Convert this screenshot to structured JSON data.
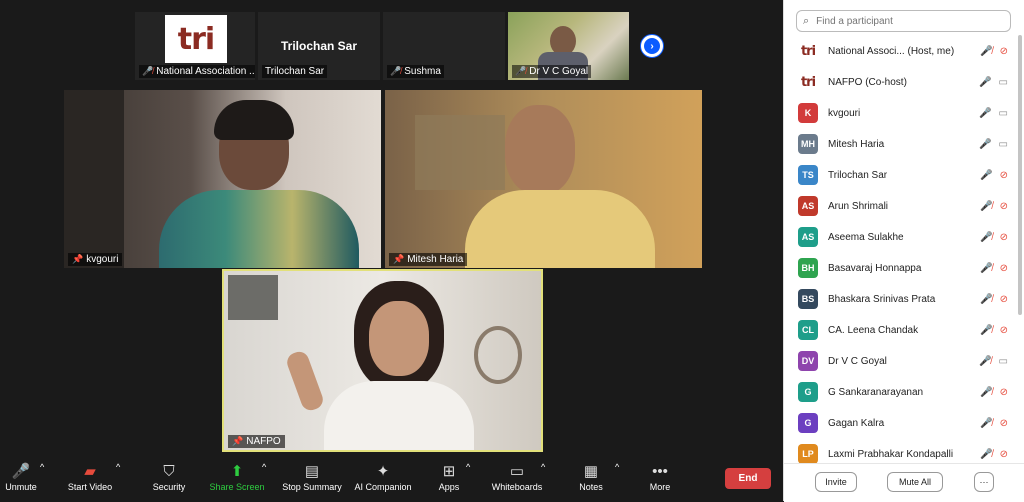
{
  "thumbnails": [
    {
      "name": "National Association ...",
      "logo_text": "tri",
      "muted": true
    },
    {
      "name": "Trilochan Sar",
      "big_name": "Trilochan Sar",
      "muted": false
    },
    {
      "name": "Sushma",
      "muted": true
    },
    {
      "name": "Dr V C Goyal",
      "muted": true
    }
  ],
  "videos": [
    {
      "name": "kvgouri"
    },
    {
      "name": "Mitesh Haria"
    },
    {
      "name": "NAFPO"
    }
  ],
  "toolbar": {
    "unmute": "Unmute",
    "start_video": "Start Video",
    "security": "Security",
    "share_screen": "Share Screen",
    "stop_summary": "Stop Summary",
    "ai_companion": "AI Companion",
    "apps": "Apps",
    "whiteboards": "Whiteboards",
    "notes": "Notes",
    "more": "More",
    "end": "End"
  },
  "panel": {
    "search_placeholder": "Find a participant",
    "participants": [
      {
        "initials": "tri",
        "name": "National Associ... (Host, me)",
        "color": "#ffffff",
        "mic": "off",
        "video": "off",
        "logo": true
      },
      {
        "initials": "tri",
        "name": "NAFPO (Co-host)",
        "color": "#ffffff",
        "mic": "on",
        "video": "on",
        "logo": true
      },
      {
        "initials": "K",
        "name": "kvgouri",
        "color": "#d23b3b",
        "mic": "on",
        "video": "on"
      },
      {
        "initials": "MH",
        "name": "Mitesh Haria",
        "color": "#6b7b8c",
        "mic": "on",
        "video": "on"
      },
      {
        "initials": "TS",
        "name": "Trilochan Sar",
        "color": "#3a86c8",
        "mic": "on",
        "video": "off"
      },
      {
        "initials": "AS",
        "name": "Arun Shrimali",
        "color": "#c0392b",
        "mic": "off",
        "video": "off"
      },
      {
        "initials": "AS",
        "name": "Aseema Sulakhe",
        "color": "#1e9e8a",
        "mic": "off",
        "video": "off"
      },
      {
        "initials": "BH",
        "name": "Basavaraj Honnappa",
        "color": "#2ea44f",
        "mic": "off",
        "video": "off"
      },
      {
        "initials": "BS",
        "name": "Bhaskara Srinivas Prata",
        "color": "#34495e",
        "mic": "off",
        "video": "off"
      },
      {
        "initials": "CL",
        "name": "CA. Leena Chandak",
        "color": "#1e9e8a",
        "mic": "off",
        "video": "off"
      },
      {
        "initials": "DV",
        "name": "Dr V C Goyal",
        "color": "#8e44ad",
        "mic": "off",
        "video": "on"
      },
      {
        "initials": "G",
        "name": "G Sankaranarayanan",
        "color": "#1e9e8a",
        "mic": "off",
        "video": "off"
      },
      {
        "initials": "G",
        "name": "Gagan Kalra",
        "color": "#6c3fc0",
        "mic": "off",
        "video": "off"
      },
      {
        "initials": "LP",
        "name": "Laxmi Prabhakar Kondapalli",
        "color": "#e08a1e",
        "mic": "off",
        "video": "off"
      }
    ],
    "invite": "Invite",
    "mute_all": "Mute All",
    "more_dots": "···"
  }
}
